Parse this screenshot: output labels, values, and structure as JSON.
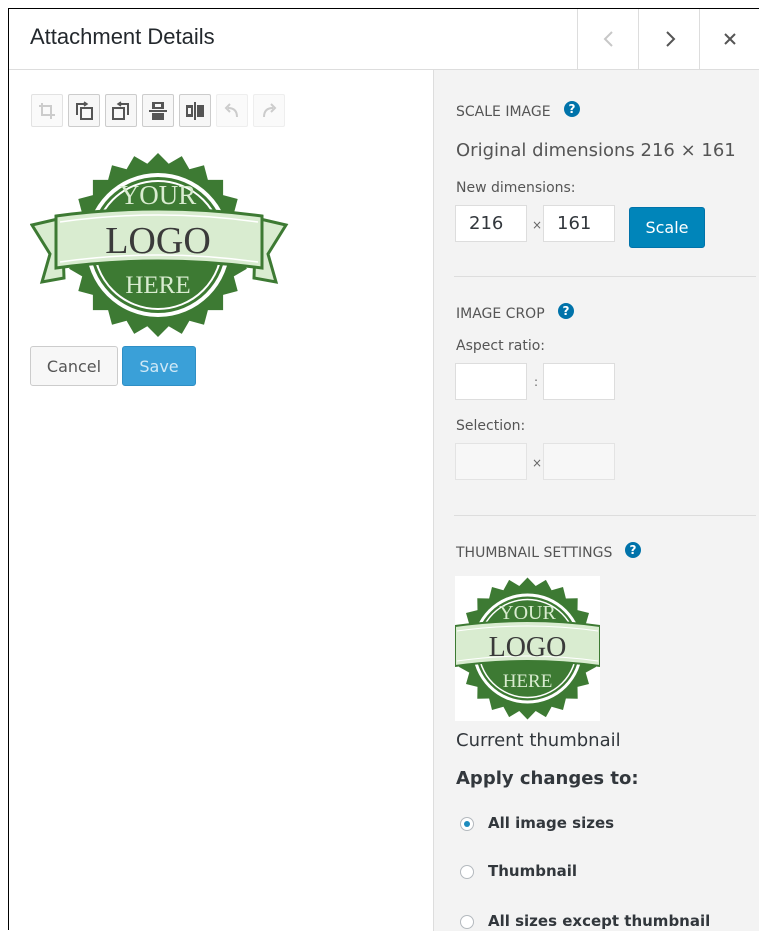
{
  "header": {
    "title": "Attachment Details"
  },
  "toolbar": {
    "tools": [
      "crop-icon",
      "rotate-left-icon",
      "rotate-right-icon",
      "flip-vertical-icon",
      "flip-horizontal-icon",
      "undo-icon",
      "redo-icon"
    ]
  },
  "logo": {
    "line1": "YOUR",
    "line2": "LOGO",
    "line3": "HERE",
    "colors": {
      "dark_green": "#3d7a33",
      "light_green": "#d9ecd0",
      "text": "#3a3a3a"
    }
  },
  "editor": {
    "cancel_label": "Cancel",
    "save_label": "Save"
  },
  "scale": {
    "title": "SCALE IMAGE",
    "original_text": "Original dimensions 216 × 161",
    "new_label": "New dimensions:",
    "width": "216",
    "height": "161",
    "times": "×",
    "button": "Scale"
  },
  "crop": {
    "title": "IMAGE CROP",
    "aspect_label": "Aspect ratio:",
    "aspect_sep": ":",
    "selection_label": "Selection:",
    "selection_sep": "×"
  },
  "thumbnail": {
    "title": "THUMBNAIL SETTINGS",
    "caption": "Current thumbnail",
    "apply_label": "Apply changes to:",
    "options": [
      {
        "label": "All image sizes",
        "checked": true
      },
      {
        "label": "Thumbnail",
        "checked": false
      },
      {
        "label": "All sizes except thumbnail",
        "checked": false
      }
    ]
  },
  "help_glyph": "?",
  "colors": {
    "primary_button": "#0085ba",
    "save_button_disabled": "#3aa0d8",
    "sidebar_bg": "#f3f3f3"
  }
}
